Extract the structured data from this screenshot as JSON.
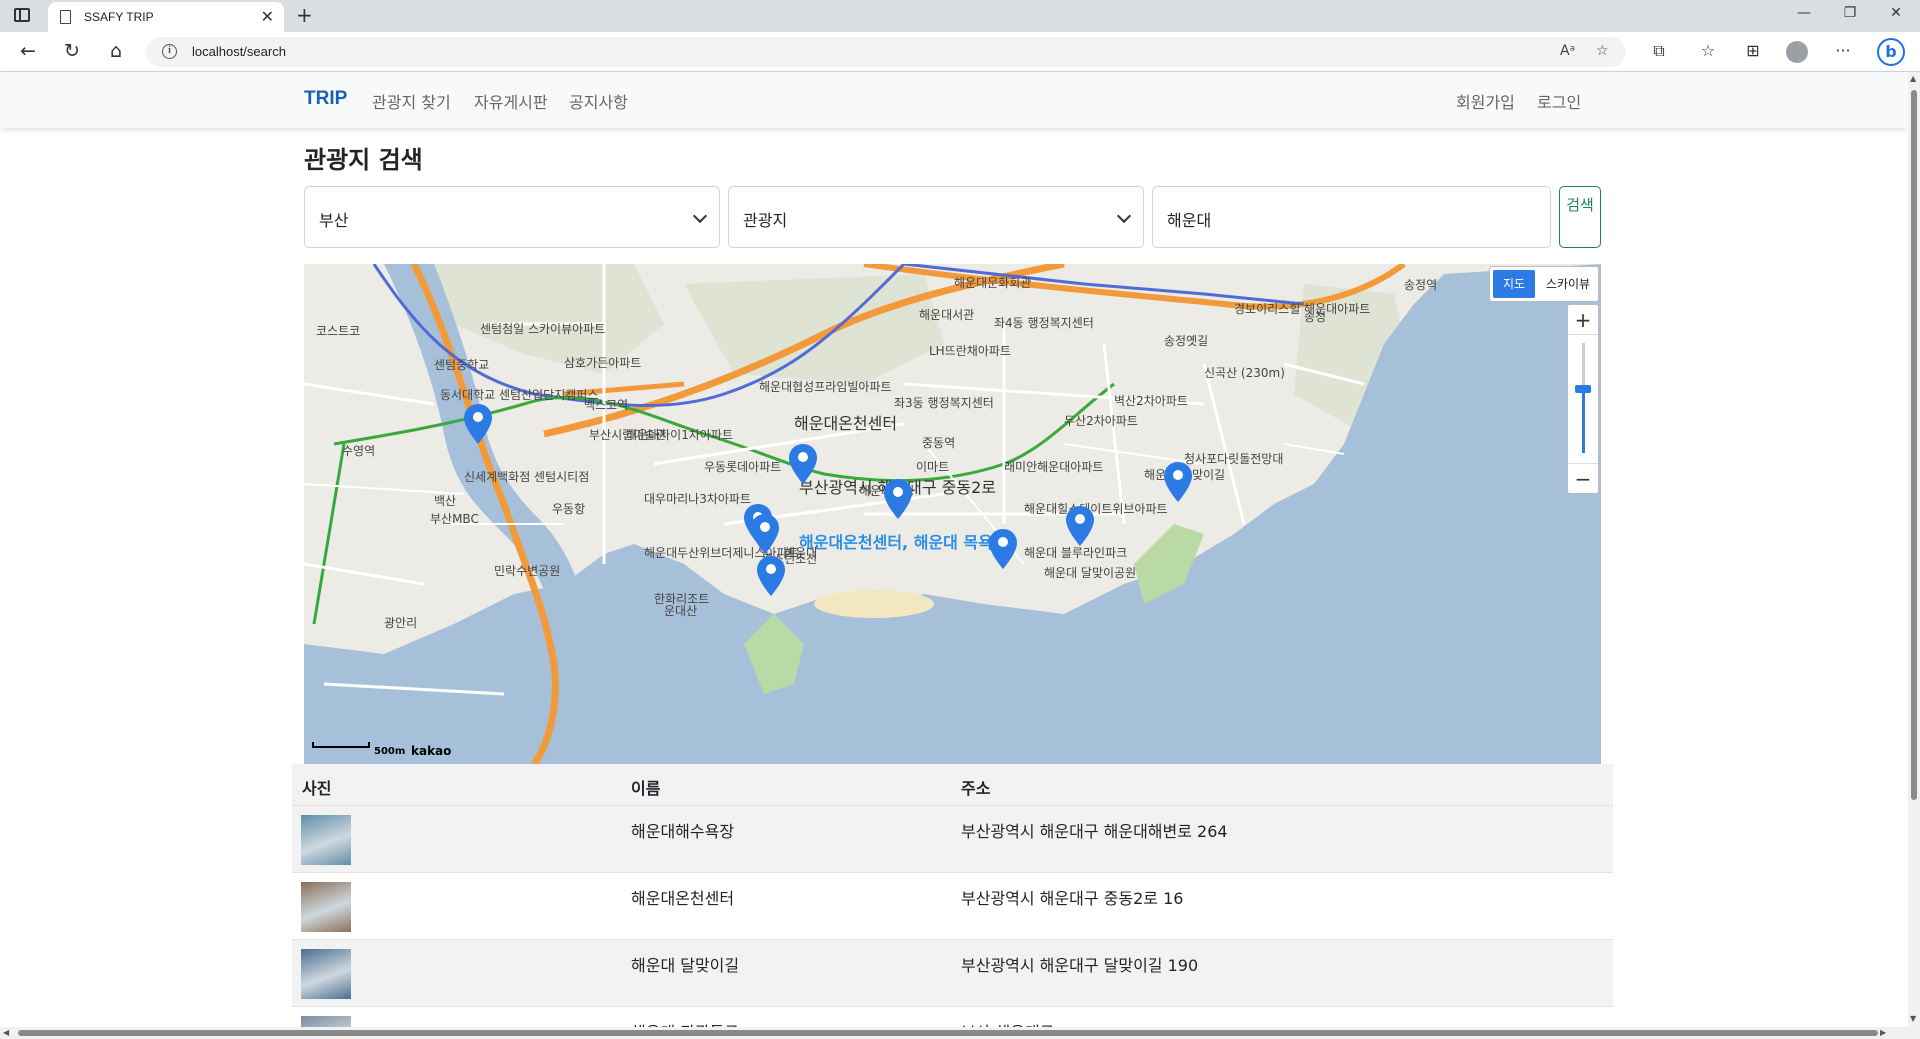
{
  "browser": {
    "tab_title": "SSAFY TRIP",
    "url": "localhost/search"
  },
  "nav": {
    "brand": "TRIP",
    "links": [
      "관광지 찾기",
      "자유게시판",
      "공지사항"
    ],
    "right_links": [
      "회원가입",
      "로그인"
    ]
  },
  "page": {
    "title": "관광지 검색"
  },
  "search": {
    "region_value": "부산",
    "type_value": "관광지",
    "keyword_value": "해운대",
    "button_label": "검색"
  },
  "map": {
    "type_on": "지도",
    "type_off": "스카이뷰",
    "zoom_in": "+",
    "zoom_out": "−",
    "scale_label": "500m",
    "provider": "kakao",
    "labels": [
      {
        "text": "해운대온천센터",
        "cls": "big"
      },
      {
        "text": "부산광역시 해운대구 중동2로",
        "cls": "big"
      },
      {
        "text": "해운대온천센터, 해운대 목욕탕",
        "cls": "blue"
      },
      {
        "text": "센텀중학교",
        "cls": ""
      },
      {
        "text": "신세계백화점 센텀시티점",
        "cls": ""
      },
      {
        "text": "수영역",
        "cls": ""
      },
      {
        "text": "벡스코역",
        "cls": ""
      },
      {
        "text": "부산시립미술관",
        "cls": ""
      },
      {
        "text": "해운대자이1차아파트",
        "cls": ""
      },
      {
        "text": "우동롯데아파트",
        "cls": ""
      },
      {
        "text": "대우마리나3차아파트",
        "cls": ""
      },
      {
        "text": "해운대두산위브더제니스아파트",
        "cls": ""
      },
      {
        "text": "한화리조트",
        "cls": ""
      },
      {
        "text": "운대산",
        "cls": ""
      },
      {
        "text": "이마트",
        "cls": ""
      },
      {
        "text": "중동역",
        "cls": ""
      },
      {
        "text": "좌3동 행정복지센터",
        "cls": ""
      },
      {
        "text": "좌4동 행정복지센터",
        "cls": ""
      },
      {
        "text": "해운대서관",
        "cls": ""
      },
      {
        "text": "LH뜨란채아파트",
        "cls": ""
      },
      {
        "text": "래미안해운대아파트",
        "cls": ""
      },
      {
        "text": "해운대힐스테이트위브아파트",
        "cls": ""
      },
      {
        "text": "해운대 블루라인파크",
        "cls": ""
      },
      {
        "text": "해운대 달맞이공원",
        "cls": ""
      },
      {
        "text": "해운대 달맞이길",
        "cls": ""
      },
      {
        "text": "청사포다릿돌전망대",
        "cls": ""
      },
      {
        "text": "신곡산 (230m)",
        "cls": ""
      },
      {
        "text": "송정역",
        "cls": ""
      },
      {
        "text": "송정옛길",
        "cls": ""
      },
      {
        "text": "백산",
        "cls": ""
      },
      {
        "text": "부산MBC",
        "cls": ""
      },
      {
        "text": "우동항",
        "cls": ""
      },
      {
        "text": "민락수변공원",
        "cls": ""
      },
      {
        "text": "광안리",
        "cls": ""
      },
      {
        "text": "코스트코",
        "cls": ""
      },
      {
        "text": "센텀첨일 스카이뷰아파트",
        "cls": ""
      },
      {
        "text": "동서대학교 센텀산업단지캠퍼스",
        "cls": ""
      },
      {
        "text": "삼호가든아파트",
        "cls": ""
      },
      {
        "text": "해운대협성프라임빌아파트",
        "cls": ""
      },
      {
        "text": "웨스틴조선",
        "cls": ""
      },
      {
        "text": "해운대",
        "cls": ""
      },
      {
        "text": "해운대구청",
        "cls": ""
      },
      {
        "text": "두산2차아파트",
        "cls": ""
      },
      {
        "text": "벽산2차아파트",
        "cls": ""
      },
      {
        "text": "경보이리스힐 해운대아파트",
        "cls": ""
      },
      {
        "text": "송정",
        "cls": ""
      },
      {
        "text": "해운대문화회관",
        "cls": ""
      }
    ]
  },
  "table": {
    "headers": {
      "photo": "사진",
      "name": "이름",
      "address": "주소"
    },
    "rows": [
      {
        "name": "해운대해수욕장",
        "address": "부산광역시 해운대구 해운대해변로 264",
        "thumb_color": "#5f8fa8"
      },
      {
        "name": "해운대온천센터",
        "address": "부산광역시 해운대구 중동2로 16",
        "thumb_color": "#8a6f5a"
      },
      {
        "name": "해운대 달맞이길",
        "address": "부산광역시 해운대구 달맞이길 190",
        "thumb_color": "#4a6f8f"
      },
      {
        "name": "해운대 관광특구",
        "address": "부산 해운대구",
        "thumb_color": "#7c8c9c"
      }
    ]
  },
  "colors": {
    "brand": "#1a5fb4",
    "search_button": "#198754",
    "map_type_active": "#2c7be5",
    "marker": "#2c7be5",
    "sea": "#a7c0d9",
    "road_highway": "#f29a3a",
    "subway_line": "#4f6bd6",
    "green_line": "#38a93c"
  }
}
